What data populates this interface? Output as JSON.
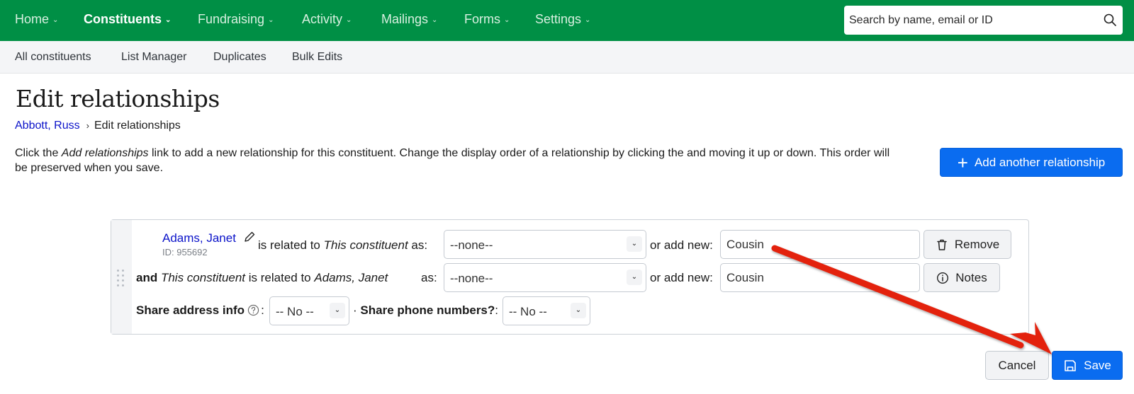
{
  "topnav": {
    "items": [
      {
        "label": "Home",
        "active": false
      },
      {
        "label": "Constituents",
        "active": true
      },
      {
        "label": "Fundraising",
        "active": false
      },
      {
        "label": "Activity",
        "active": false
      },
      {
        "label": "Mailings",
        "active": false
      },
      {
        "label": "Forms",
        "active": false
      },
      {
        "label": "Settings",
        "active": false
      }
    ],
    "search_placeholder": "Search by name, email or ID",
    "search_value": "",
    "search_icon": "search-icon",
    "background_color": "#008f45"
  },
  "subnav": {
    "items": [
      "All constituents",
      "List Manager",
      "Duplicates",
      "Bulk Edits"
    ]
  },
  "page": {
    "title": "Edit relationships",
    "breadcrumb": {
      "parent": "Abbott, Russ",
      "separator": "›",
      "current": "Edit relationships"
    },
    "description": {
      "part1": "Click the ",
      "italic": "Add relationships",
      "part2": " link to add a new relationship for this constituent. Change the display order of a relationship by clicking the and moving it up or down. This order will be preserved when you save."
    },
    "add_button": {
      "label": "Add another relationship",
      "icon": "plus-icon",
      "color": "#0a6cf0"
    }
  },
  "relationship": {
    "name": "Adams, Janet",
    "id_label": "ID: 955692",
    "row1": {
      "text_before": "is related to ",
      "italic": "This constituent",
      "text_after": " as:",
      "select_value": "--none--",
      "or_add_new_label": "or add new:",
      "new_value": "Cousin",
      "button_label": "Remove",
      "button_icon": "trash-icon"
    },
    "row2": {
      "and_label": "and",
      "italic1": "This constituent",
      "middle": " is related to ",
      "italic2": "Adams, Janet",
      "as_label": "as:",
      "select_value": "--none--",
      "or_add_new_label": "or add new:",
      "new_value": "Cousin",
      "button_label": "Notes",
      "button_icon": "info-icon"
    },
    "row3": {
      "share_address_label": "Share address info",
      "share_address_value": "-- No --",
      "colon": ":",
      "separator": "·",
      "share_phone_label": "Share phone numbers?",
      "share_phone_colon": ":",
      "share_phone_value": "-- No --"
    }
  },
  "footer": {
    "cancel_label": "Cancel",
    "save_label": "Save",
    "save_icon": "floppy-disk-icon"
  },
  "annotation": {
    "type": "arrow",
    "color": "#e3210f",
    "points_to": "save-button"
  }
}
